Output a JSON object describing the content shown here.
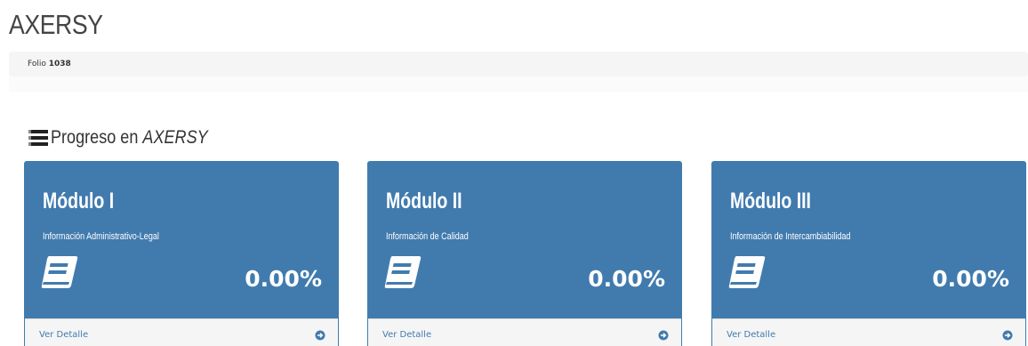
{
  "header": {
    "title": "AXERSY",
    "folio_label": "Folio",
    "folio_number": "1038"
  },
  "section": {
    "title_prefix": "Progreso en",
    "title_brand": "AXERSY",
    "icon": "list-bars-icon"
  },
  "colors": {
    "card_bg": "#417bae",
    "link": "#417bae",
    "footer_bg": "#f5f5f5"
  },
  "modules": [
    {
      "title": "Módulo I",
      "subtitle": "Información Administrativo-Legal",
      "percent": "0.00%",
      "link": "Ver Detalle",
      "icon": "book-icon"
    },
    {
      "title": "Módulo II",
      "subtitle": "Información de Calidad",
      "percent": "0.00%",
      "link": "Ver Detalle",
      "icon": "book-icon"
    },
    {
      "title": "Módulo III",
      "subtitle": "Información de Intercambiabilidad",
      "percent": "0.00%",
      "link": "Ver Detalle",
      "icon": "book-icon"
    }
  ]
}
